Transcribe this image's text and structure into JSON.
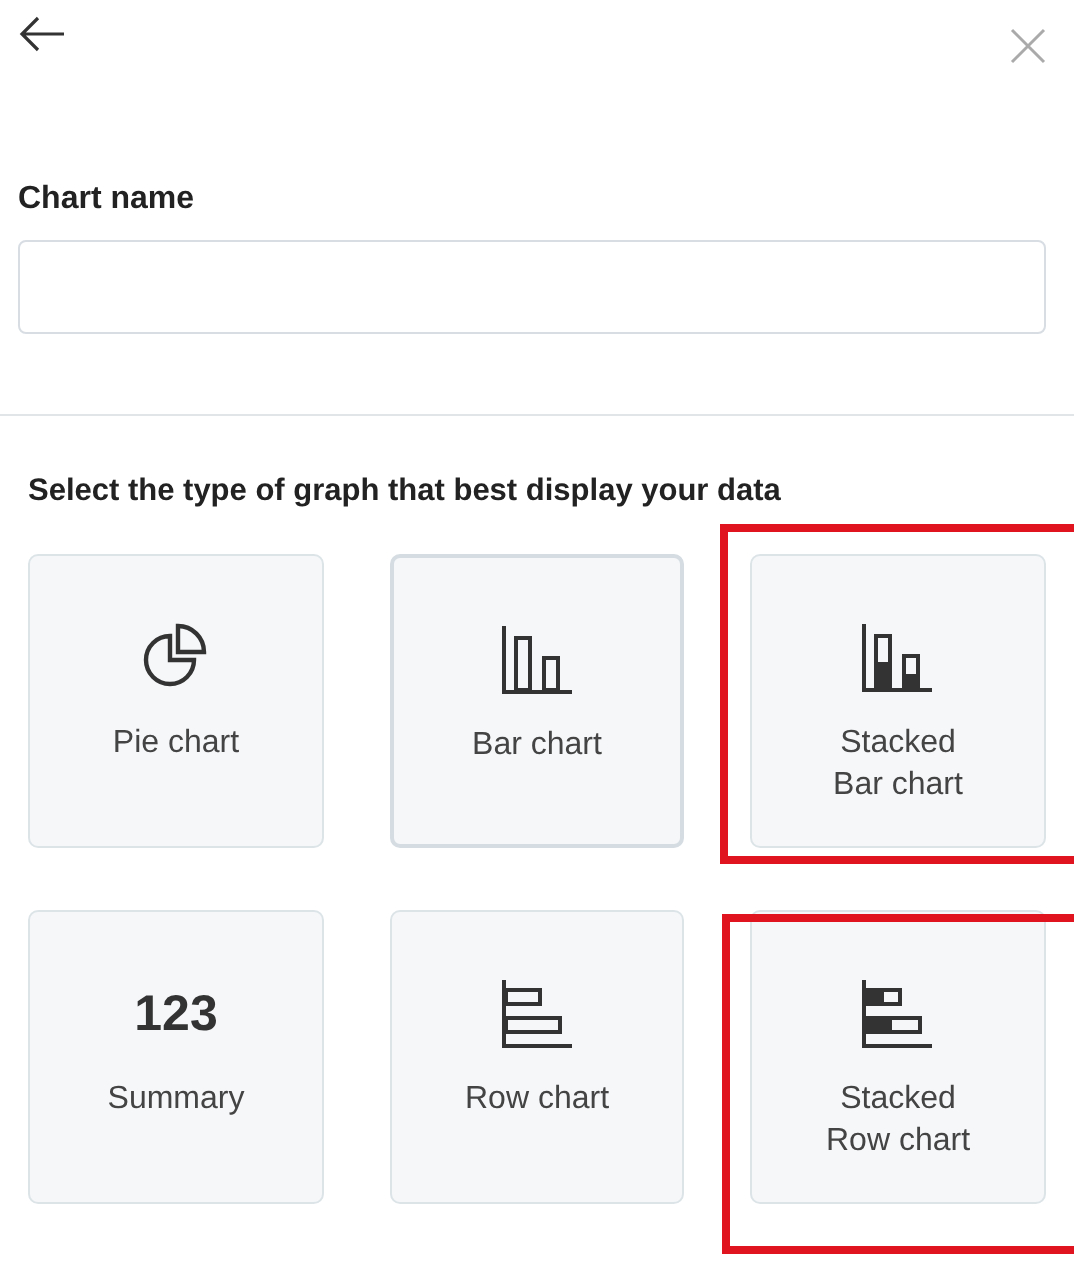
{
  "chart_name": {
    "label": "Chart name"
  },
  "prompt": "Select the type of graph that best display your data",
  "chart_types": [
    {
      "kind": "pie",
      "label": "Pie chart",
      "selected": false,
      "highlighted": false
    },
    {
      "kind": "bar",
      "label": "Bar chart",
      "selected": true,
      "highlighted": false
    },
    {
      "kind": "stacked-bar",
      "label": "Stacked\nBar chart",
      "selected": false,
      "highlighted": true
    },
    {
      "kind": "number",
      "number": "123",
      "label": "Summary",
      "selected": false,
      "highlighted": false
    },
    {
      "kind": "row",
      "label": "Row chart",
      "selected": false,
      "highlighted": false
    },
    {
      "kind": "stacked-row",
      "label": "Stacked\nRow chart",
      "selected": false,
      "highlighted": true
    }
  ]
}
